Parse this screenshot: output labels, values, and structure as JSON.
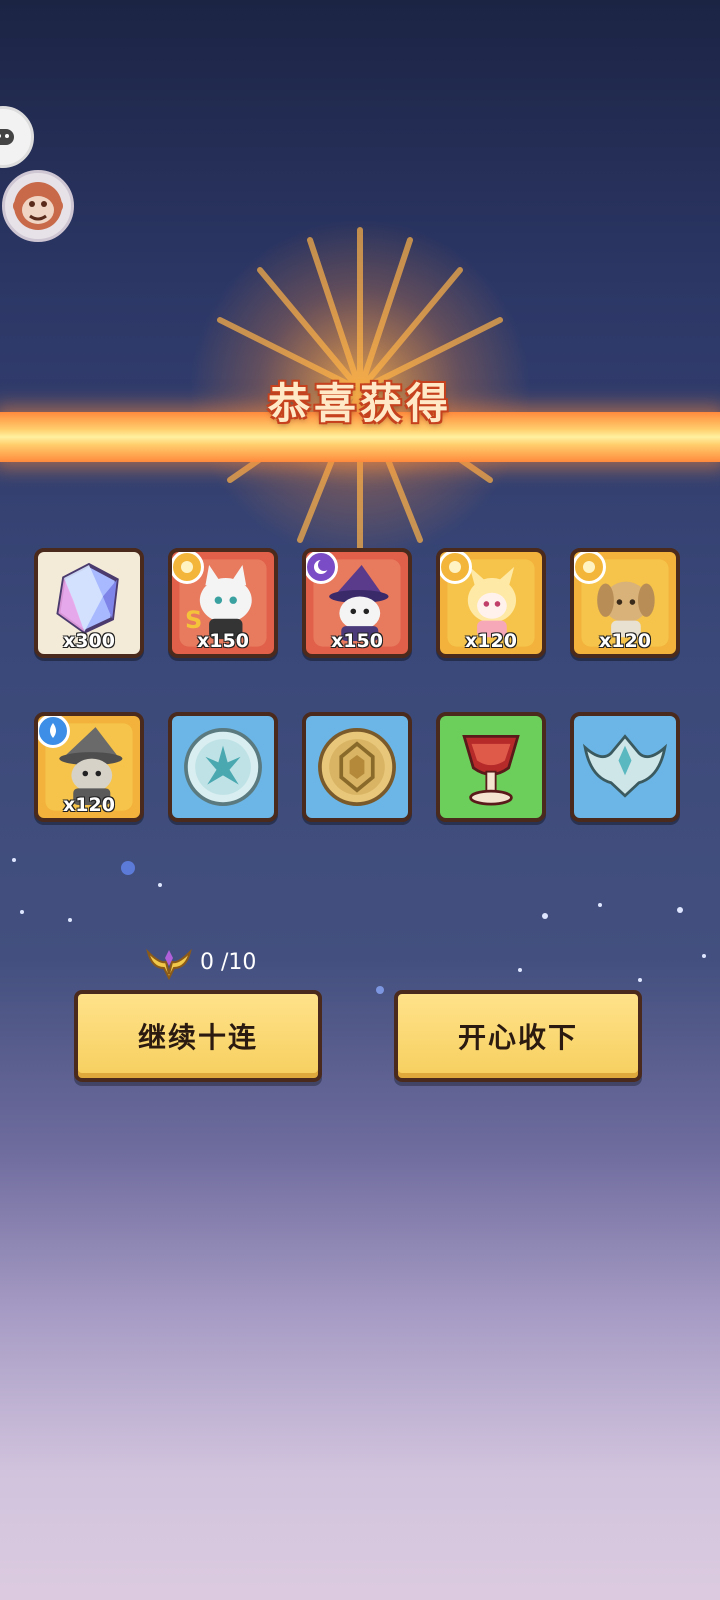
{
  "title": "恭喜获得",
  "rewards_row1": [
    {
      "item": "crystal-gem",
      "quantity": "x300"
    },
    {
      "item": "white-cat-hero-fragment",
      "quantity": "x150"
    },
    {
      "item": "wizard-cat-hero-fragment",
      "quantity": "x150"
    },
    {
      "item": "blonde-girl-hero-fragment",
      "quantity": "x120"
    },
    {
      "item": "dog-hero-fragment",
      "quantity": "x120"
    }
  ],
  "rewards_row2": [
    {
      "item": "gray-witch-hero-fragment",
      "quantity": "x120"
    },
    {
      "item": "silver-medal",
      "quantity": ""
    },
    {
      "item": "gold-medal",
      "quantity": ""
    },
    {
      "item": "red-goblet",
      "quantity": ""
    },
    {
      "item": "silver-crown",
      "quantity": ""
    }
  ],
  "pity_counter": "0 /10",
  "buttons": {
    "continue": "继续十连",
    "accept": "开心收下"
  },
  "colors": {
    "banner": "#ffcf6d",
    "button": "#f6cf5e",
    "border": "#4a2a1c"
  }
}
